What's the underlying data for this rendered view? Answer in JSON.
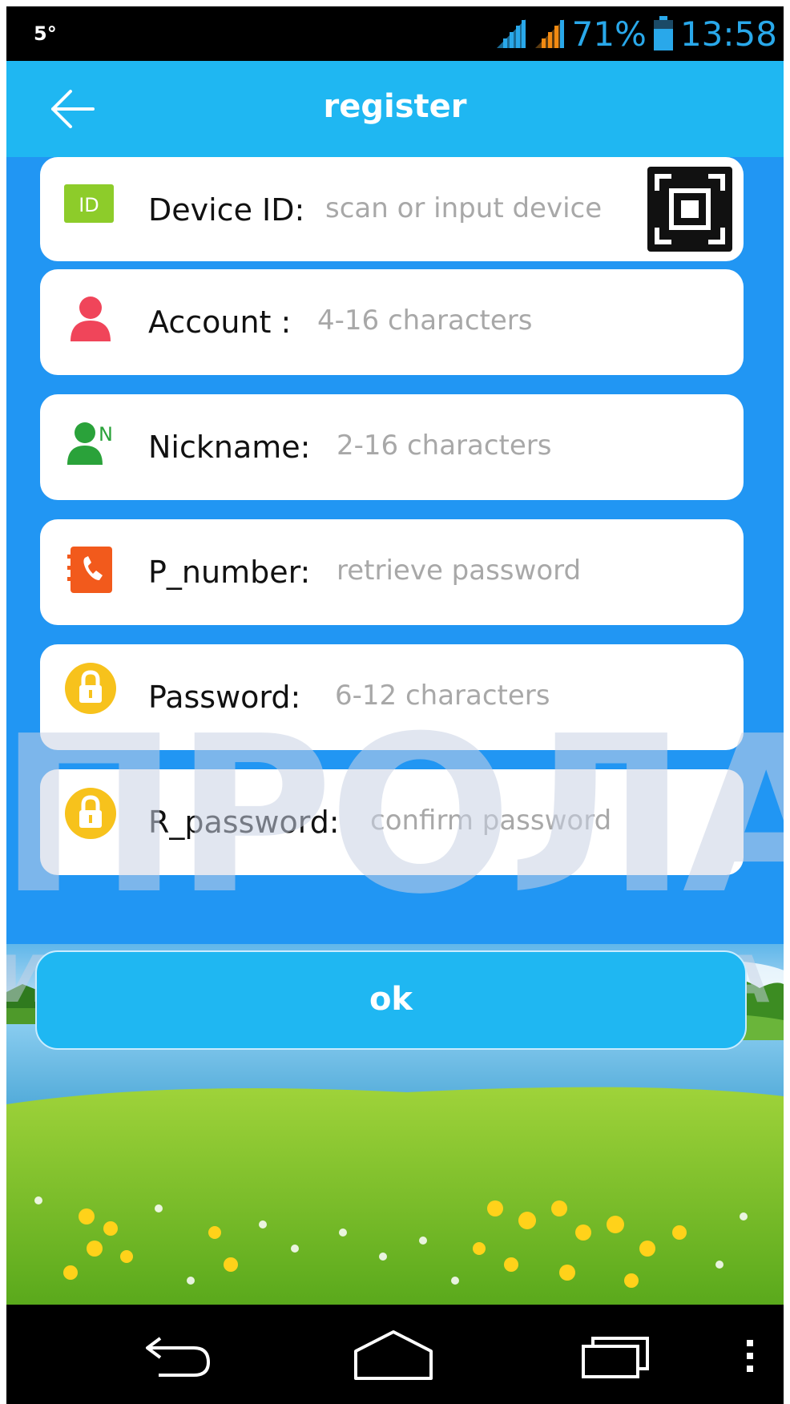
{
  "status_bar": {
    "left_text": "5°",
    "battery_percent": "71%",
    "battery_level": 0.71,
    "time": "13:58",
    "accent_color": "#29a8ea"
  },
  "app_bar": {
    "title": "register",
    "back_icon": "arrow-left-icon",
    "background_color": "#1fb7f2"
  },
  "form": {
    "fields": [
      {
        "icon": "id-card-icon",
        "label": "Device ID:",
        "placeholder": "scan or input device",
        "value": ""
      },
      {
        "icon": "user-icon",
        "label": "Account :",
        "placeholder": "4-16 characters",
        "value": ""
      },
      {
        "icon": "user-nickname-icon",
        "label": "Nickname:",
        "placeholder": "2-16 characters",
        "value": ""
      },
      {
        "icon": "phone-book-icon",
        "label": "P_number:",
        "placeholder": "retrieve password",
        "value": ""
      },
      {
        "icon": "lock-icon",
        "label": "Password:",
        "placeholder": "6-12 characters",
        "value": ""
      },
      {
        "icon": "lock-icon",
        "label": "R_password:",
        "placeholder": "confirm password",
        "value": ""
      }
    ],
    "scan_icon": "qr-scan-icon",
    "ok_label": "ok"
  },
  "watermark": {
    "line1": "ПРОЛА",
    "line2": "ИСТЕМЫ БЕЗОПА"
  },
  "nav_bar": {
    "items": [
      "back-icon",
      "home-icon",
      "recent-apps-icon",
      "menu-icon"
    ]
  }
}
